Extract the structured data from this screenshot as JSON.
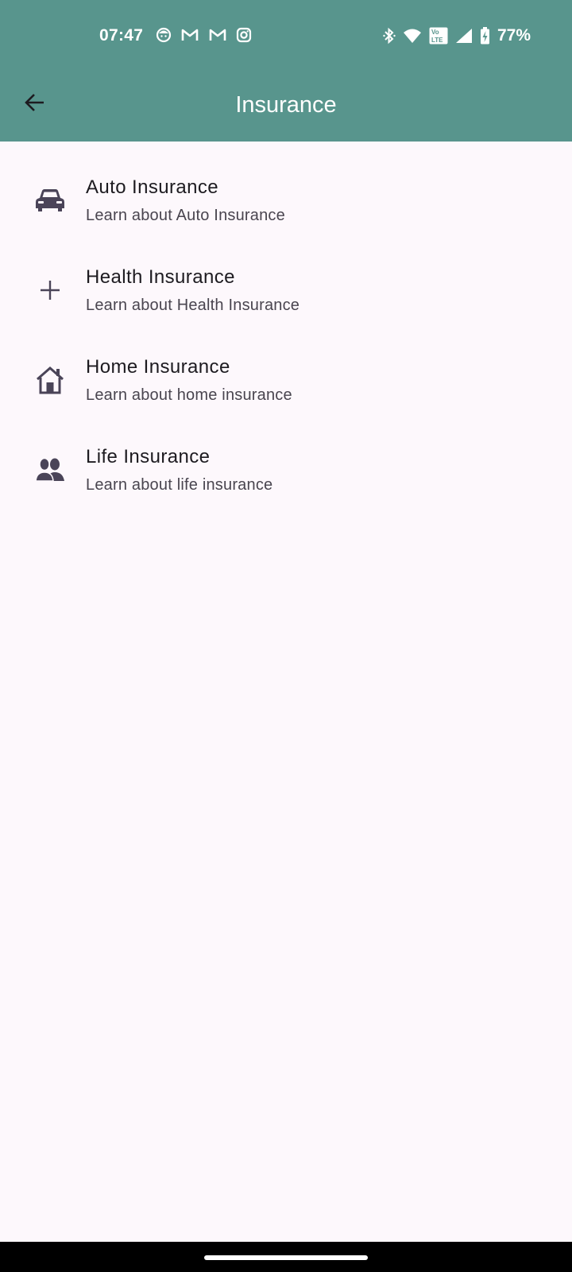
{
  "status_bar": {
    "time": "07:47",
    "battery_percent": "77%",
    "notification_icons": [
      "face-icon",
      "gmail-icon",
      "gmail-icon",
      "instagram-icon"
    ],
    "system_icons": [
      "bluetooth-icon",
      "wifi-icon",
      "volte-icon",
      "signal-icon",
      "battery-charging-icon"
    ]
  },
  "app_bar": {
    "title": "Insurance",
    "back_icon": "arrow-back-icon",
    "background": "#58958d"
  },
  "items": [
    {
      "title": "Auto Insurance",
      "subtitle": "Learn about Auto Insurance",
      "icon": "car-icon"
    },
    {
      "title": "Health Insurance",
      "subtitle": "Learn about Health Insurance",
      "icon": "plus-icon"
    },
    {
      "title": "Home Insurance",
      "subtitle": "Learn about home insurance",
      "icon": "house-icon"
    },
    {
      "title": "Life Insurance",
      "subtitle": "Learn about life insurance",
      "icon": "people-icon"
    }
  ],
  "colors": {
    "page_background": "#fdf8fc",
    "title_text": "#1d1b20",
    "subtitle_text": "#49454f",
    "icon": "#4a4458"
  }
}
